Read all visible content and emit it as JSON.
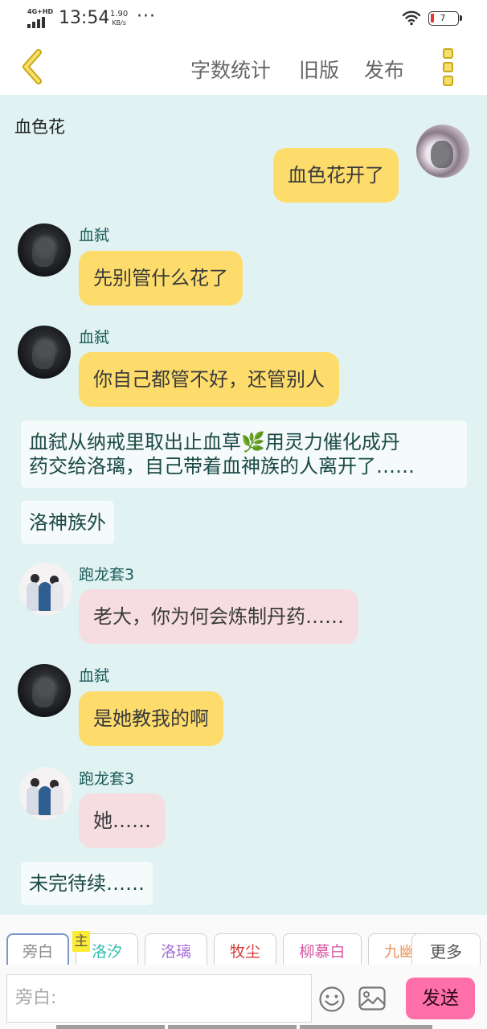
{
  "status_bar": {
    "network": "4G+HD",
    "time": "13:54",
    "speed_value": "1.90",
    "speed_unit": "KB/s",
    "more": "···",
    "battery": "7"
  },
  "header": {
    "back_icon": "chevron-left-icon",
    "word_count": "字数统计",
    "old_version": "旧版",
    "publish": "发布",
    "more_icon": "vertical-dots-icon"
  },
  "chat": {
    "title": "血色花",
    "messages": [
      {
        "speaker": "",
        "text": "血色花开了",
        "side": "right"
      },
      {
        "speaker": "血弑",
        "text": "先别管什么花了"
      },
      {
        "speaker": "血弑",
        "text": "你自己都管不好，还管别人"
      },
      {
        "narration": "血弑从纳戒里取出止血草🌿用灵力催化成丹药交给洛璃，自己带着血神族的人离开了……",
        "line1": "血弑从纳戒里取出止血草🌿用灵力催化成丹",
        "line2": "药交给洛璃，自己带着血神族的人离开了……"
      },
      {
        "narration": "洛神族外"
      },
      {
        "speaker": "跑龙套3",
        "text": "老大，你为何会炼制丹药……"
      },
      {
        "speaker": "血弑",
        "text": "是她教我的啊"
      },
      {
        "speaker": "跑龙套3",
        "text": "她……"
      },
      {
        "narration": "未完待续……"
      }
    ]
  },
  "characters": {
    "items": [
      {
        "label": "旁白",
        "color": "#8a8a8a"
      },
      {
        "label": "洛汐",
        "color": "#2fbfb0"
      },
      {
        "label": "洛璃",
        "color": "#a86fd8"
      },
      {
        "label": "牧尘",
        "color": "#d83b3b"
      },
      {
        "label": "柳慕白",
        "color": "#d858a4"
      },
      {
        "label": "九幽",
        "color": "#e8955a"
      }
    ],
    "main_tag": "主",
    "more": "更多"
  },
  "input": {
    "placeholder": "旁白:",
    "emoji_icon": "smile-icon",
    "image_icon": "image-icon",
    "send": "发送"
  },
  "colors": {
    "chat_bg": "#e0f2f2",
    "yellow_bubble": "#fddc6c",
    "pink_bubble": "#f6dde2",
    "send_button": "#ff6faa"
  }
}
